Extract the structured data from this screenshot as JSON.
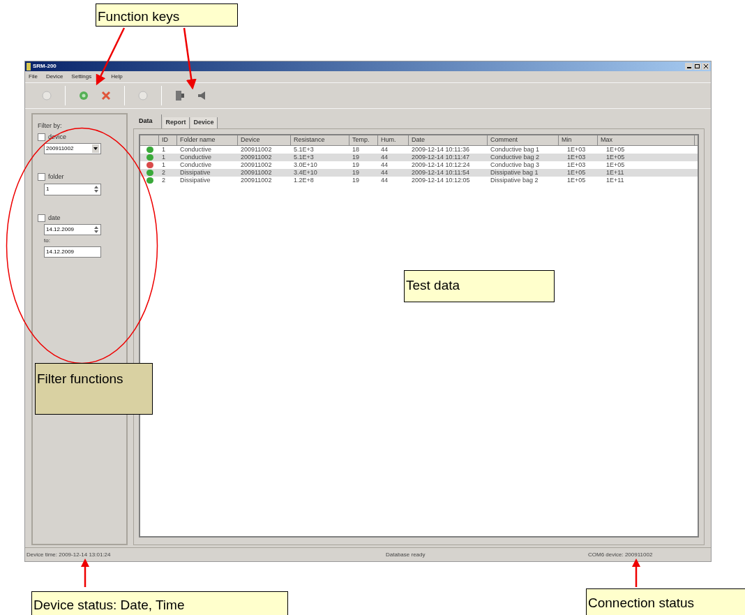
{
  "window": {
    "title": "SRM-200"
  },
  "menu": [
    "File",
    "Device",
    "Settings",
    "Help"
  ],
  "toolbar": [
    {
      "kind": "circle",
      "disabled": true
    },
    {
      "kind": "separator"
    },
    {
      "kind": "connect",
      "disabled": false
    },
    {
      "kind": "cancel",
      "disabled": false
    },
    {
      "kind": "separator"
    },
    {
      "kind": "circle",
      "disabled": true
    },
    {
      "kind": "separator"
    },
    {
      "kind": "exit",
      "disabled": false
    },
    {
      "kind": "speaker",
      "disabled": false
    }
  ],
  "filter": {
    "label": "Filter by:",
    "device": {
      "label": "device",
      "checked": false,
      "value": "200911002"
    },
    "folder": {
      "label": "folder",
      "checked": false,
      "value": "1"
    },
    "date": {
      "label": "date",
      "checked": false,
      "from": "14.12.2009",
      "to_label": "to:",
      "to": "14.12.2009"
    }
  },
  "tabs": [
    {
      "label": "Data",
      "selected": true
    },
    {
      "label": "Report",
      "selected": false
    },
    {
      "label": "Device",
      "selected": false
    }
  ],
  "table": {
    "columns": [
      "ID",
      "Folder name",
      "Device",
      "Resistance",
      "Temp.",
      "Hum.",
      "Date",
      "Comment",
      "Min",
      "Max"
    ],
    "rows": [
      {
        "color": "#3aa93a",
        "cells": [
          "1",
          "Conductive",
          "200911002",
          "5.1E+3",
          "18",
          "44",
          "2009-12-14 10:11:36",
          "Conductive bag 1",
          "1E+03",
          "1E+05"
        ]
      },
      {
        "color": "#3aa93a",
        "cells": [
          "1",
          "Conductive",
          "200911002",
          "5.1E+3",
          "19",
          "44",
          "2009-12-14 10:11:47",
          "Conductive bag 2",
          "1E+03",
          "1E+05"
        ]
      },
      {
        "color": "#d94a4a",
        "cells": [
          "1",
          "Conductive",
          "200911002",
          "3.0E+10",
          "19",
          "44",
          "2009-12-14 10:12:24",
          "Conductive bag 3",
          "1E+03",
          "1E+05"
        ]
      },
      {
        "color": "#3aa93a",
        "cells": [
          "2",
          "Dissipative",
          "200911002",
          "3.4E+10",
          "19",
          "44",
          "2009-12-14 10:11:54",
          "Dissipative bag 1",
          "1E+05",
          "1E+11"
        ]
      },
      {
        "color": "#3aa93a",
        "cells": [
          "2",
          "Dissipative",
          "200911002",
          "1.2E+8",
          "19",
          "44",
          "2009-12-14 10:12:05",
          "Dissipative bag 2",
          "1E+05",
          "1E+11"
        ]
      }
    ]
  },
  "status_bar": [
    "Device time: 2009-12-14 13:01:24",
    "Database ready",
    "COM6 device: 200911002"
  ],
  "annotations": {
    "function_keys": "Function keys",
    "test_data": "Test data",
    "filter_functions": "Filter functions",
    "device_status": "Device status: Date, Time",
    "connection_status": "Connection status"
  }
}
